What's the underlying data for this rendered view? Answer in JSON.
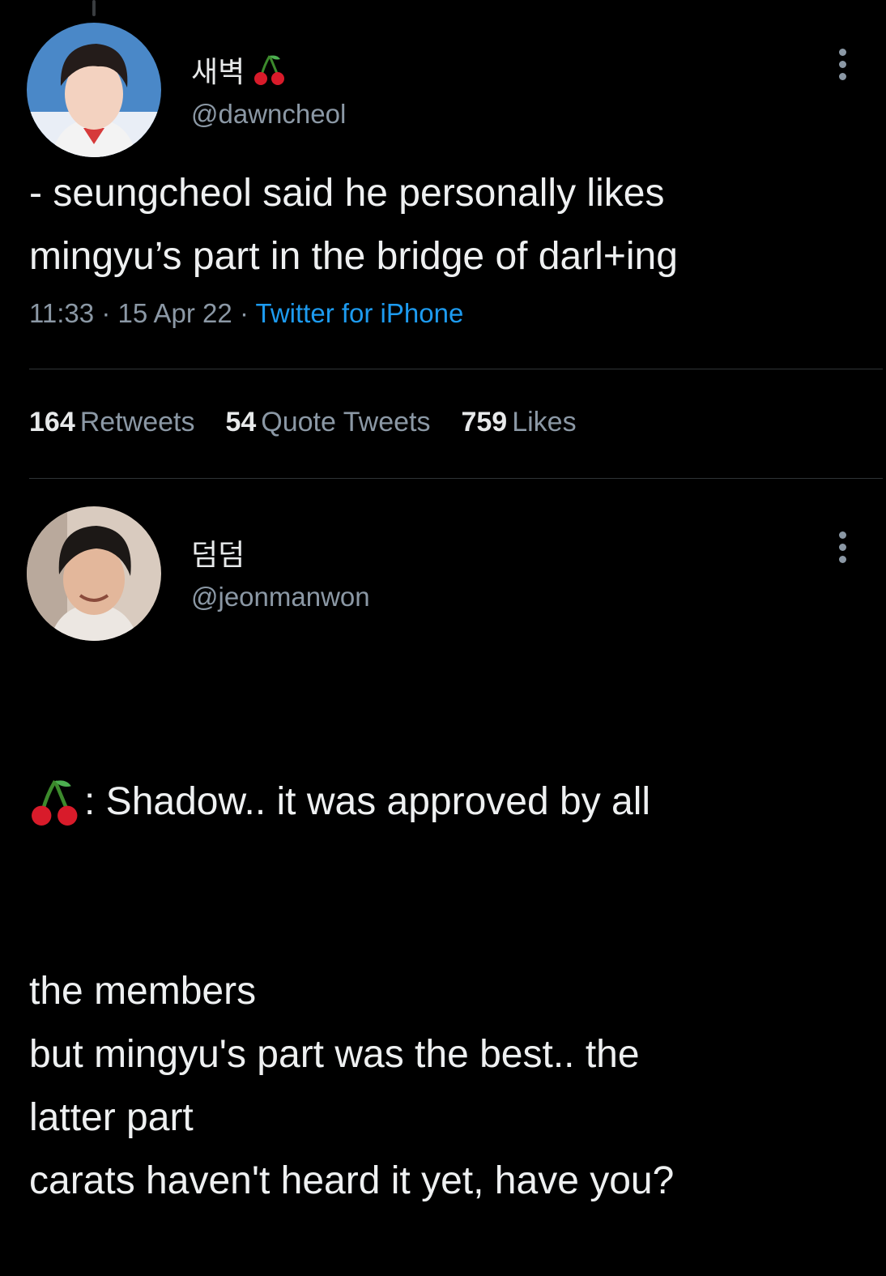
{
  "tweet1": {
    "display_name": "새벽",
    "handle": "@dawncheol",
    "text": "- seungcheol said he personally likes\nmingyu’s part in the bridge of darl+ing",
    "time": "11:33",
    "date": "15 Apr 22",
    "source": "Twitter for iPhone",
    "separator": "·",
    "stats": {
      "retweets_count": "164",
      "retweets_label": "Retweets",
      "quotes_count": "54",
      "quotes_label": "Quote Tweets",
      "likes_count": "759",
      "likes_label": "Likes"
    }
  },
  "tweet2": {
    "display_name": "덤덤",
    "handle": "@jeonmanwon",
    "text_first": ": Shadow.. it was approved by all",
    "text_rest": "the members\nbut mingyu's part was the best.. the\nlatter part\ncarats haven't heard it yet, have you?"
  },
  "icons": {
    "name_badge": "cherry-icon",
    "more": "more-options-icon"
  },
  "colors": {
    "background": "#000000",
    "text": "#e7e9ea",
    "secondary": "#8b98a5",
    "link": "#1d9bf0",
    "divider": "#2f3336"
  }
}
